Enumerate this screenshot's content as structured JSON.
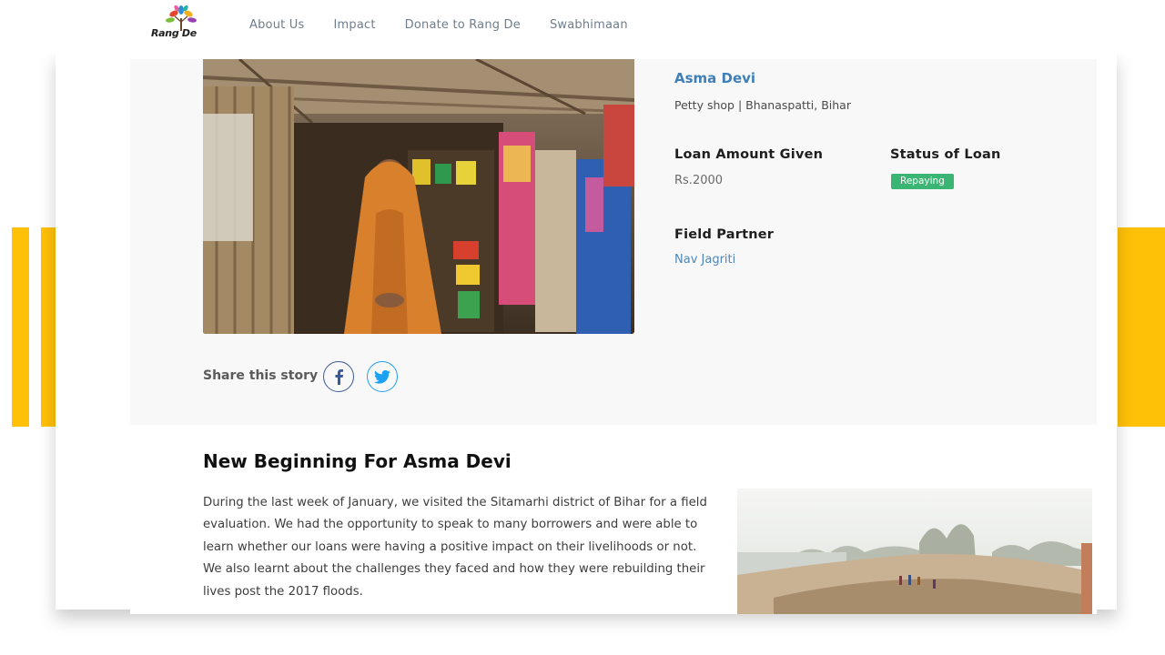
{
  "brand": {
    "logo_text": "Rang De",
    "accent_yellow": "#ffc107",
    "link_blue": "#3f7fb8",
    "status_green": "#3bb574"
  },
  "nav": {
    "items": [
      {
        "label": "About Us"
      },
      {
        "label": "Impact"
      },
      {
        "label": "Donate to Rang De"
      },
      {
        "label": "Swabhimaan"
      }
    ]
  },
  "profile": {
    "photo_icon": "shop-photo",
    "name": "Asma Devi",
    "subtitle": "Petty shop | Bhanaspatti, Bihar",
    "loan_amount_label": "Loan Amount Given",
    "loan_amount_value": "Rs.2000",
    "status_label": "Status of Loan",
    "status_value": "Repaying",
    "field_partner_label": "Field Partner",
    "field_partner_value": "Nav Jagriti"
  },
  "share": {
    "label": "Share this story",
    "icons": [
      "facebook-icon",
      "twitter-icon"
    ]
  },
  "story": {
    "title": "New Beginning For Asma Devi",
    "body": "During the last week of January, we visited the Sitamarhi district of Bihar for a field evaluation. We had the opportunity to speak to many borrowers and were able to learn whether our loans were having a positive impact on their livelihoods or not. We also learnt about the challenges they faced and how they were rebuilding their lives post the 2017 floods.",
    "photo_icon": "landscape-photo"
  }
}
